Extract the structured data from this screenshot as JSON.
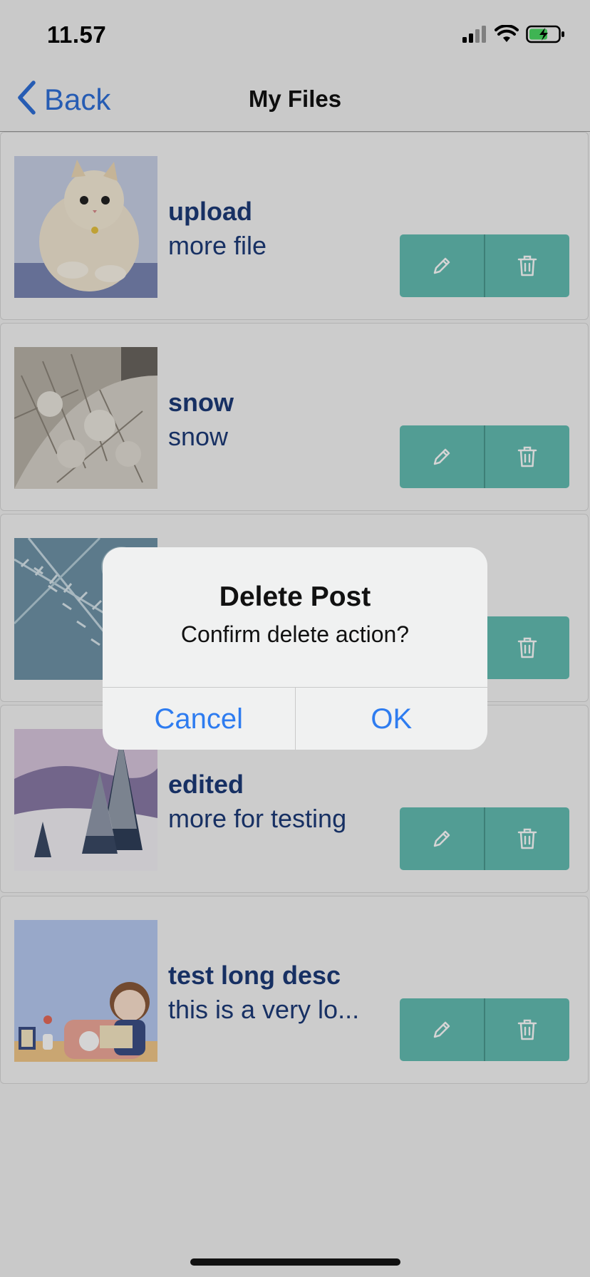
{
  "status_bar": {
    "time": "11.57"
  },
  "nav": {
    "back_label": "Back",
    "title": "My Files"
  },
  "files": [
    {
      "title": "upload",
      "description": "more file",
      "image": "kitten-photo"
    },
    {
      "title": "snow",
      "description": "snow",
      "image": "snowy-bush-photo"
    },
    {
      "title": "",
      "description": "",
      "image": "pine-branches-photo"
    },
    {
      "title": "edited",
      "description": "more for testing",
      "image": "snowy-trees-photo"
    },
    {
      "title": "test long desc",
      "description": "this is a very lo...",
      "image": "girl-reading-illustration"
    }
  ],
  "actions": {
    "edit_icon": "pencil-icon",
    "delete_icon": "trash-icon"
  },
  "dialog": {
    "title": "Delete Post",
    "message": "Confirm delete action?",
    "cancel_label": "Cancel",
    "ok_label": "OK"
  },
  "colors": {
    "accent": "#63bdb3",
    "link": "#2e7cf0",
    "text_primary": "#1c3a78"
  }
}
